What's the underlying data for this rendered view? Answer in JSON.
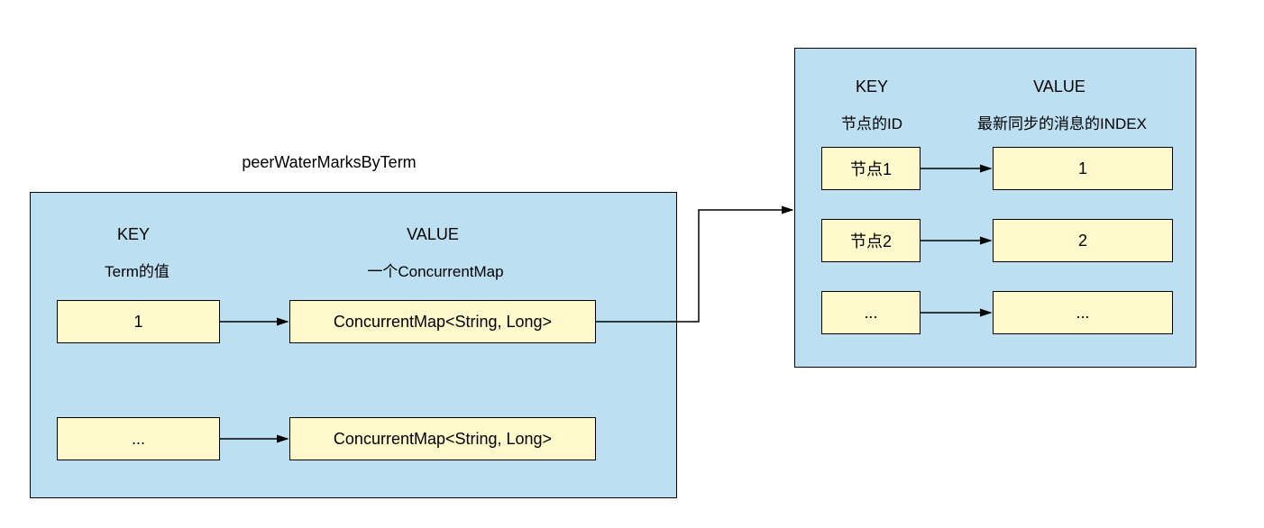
{
  "title": "peerWaterMarksByTerm",
  "left": {
    "keyHeader": "KEY",
    "keySub": "Term的值",
    "valueHeader": "VALUE",
    "valueSub": "一个ConcurrentMap",
    "rows": [
      {
        "key": "1",
        "value": "ConcurrentMap<String, Long>"
      },
      {
        "key": "...",
        "value": "ConcurrentMap<String, Long>"
      }
    ]
  },
  "right": {
    "keyHeader": "KEY",
    "keySub": "节点的ID",
    "valueHeader": "VALUE",
    "valueSub": "最新同步的消息的INDEX",
    "rows": [
      {
        "key": "节点1",
        "value": "1"
      },
      {
        "key": "节点2",
        "value": "2"
      },
      {
        "key": "...",
        "value": "..."
      }
    ]
  }
}
